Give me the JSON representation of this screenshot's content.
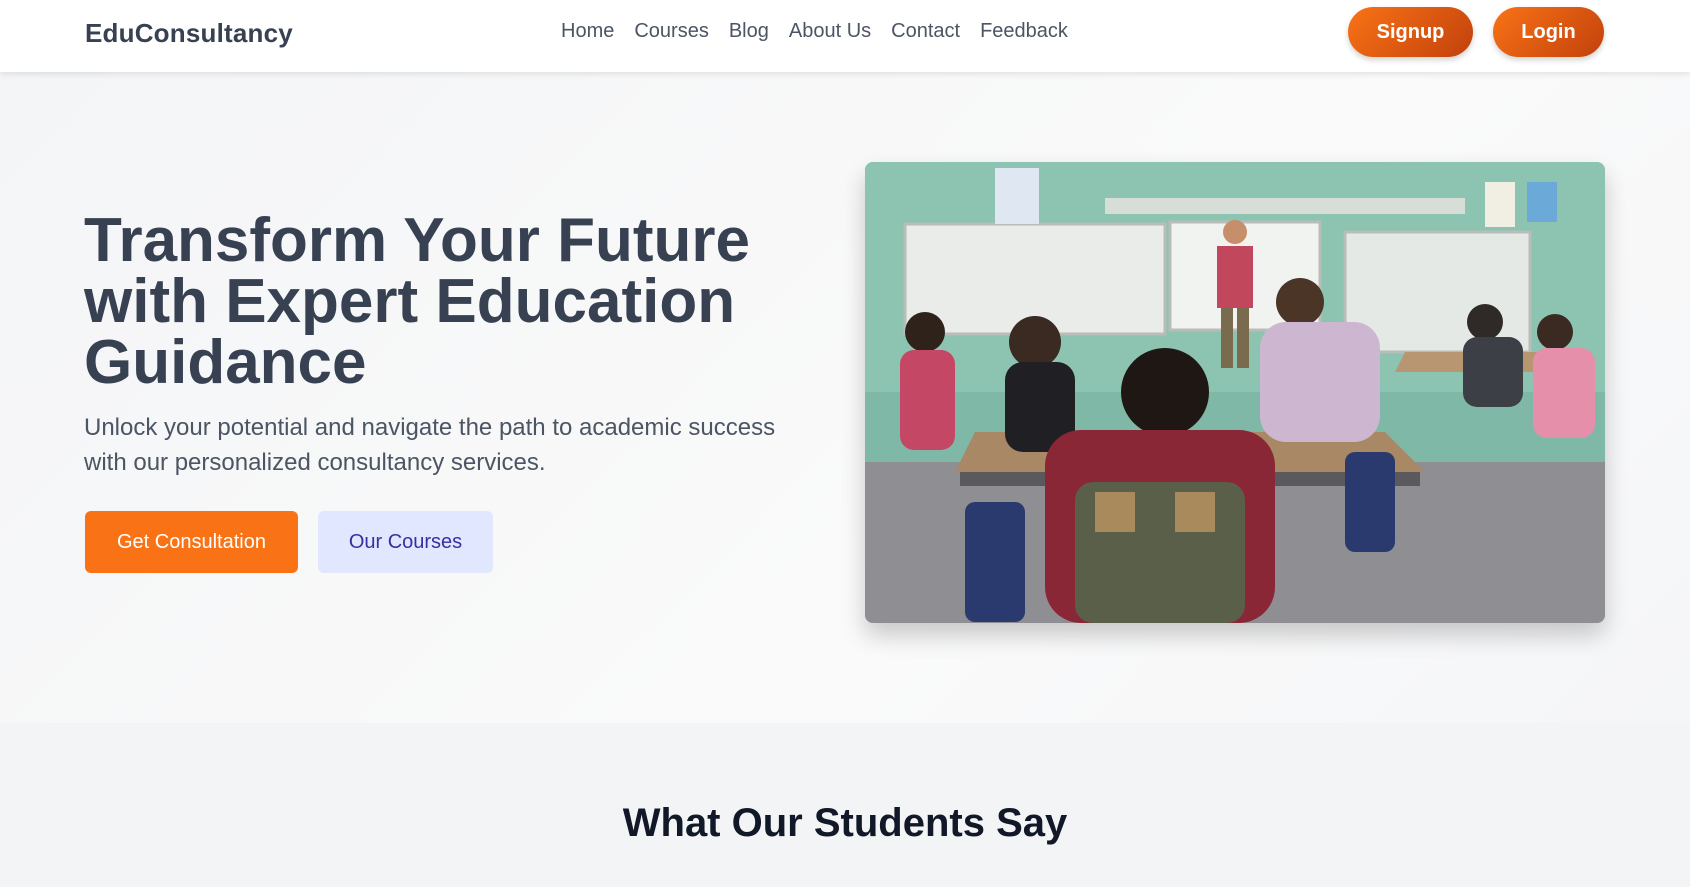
{
  "brand": {
    "name": "EduConsultancy"
  },
  "nav": {
    "links": [
      "Home",
      "Courses",
      "Blog",
      "About Us",
      "Contact",
      "Feedback"
    ],
    "signup_label": "Signup",
    "login_label": "Login"
  },
  "hero": {
    "title": "Transform Your Future with Expert Education Guidance",
    "subtitle": "Unlock your potential and navigate the path to academic success with our personalized consultancy services.",
    "primary_cta": "Get Consultation",
    "secondary_cta": "Our Courses",
    "image_icon": "classroom-photo"
  },
  "testimonials": {
    "title": "What Our Students Say"
  },
  "colors": {
    "accent": "#f97316",
    "accent_dark": "#c2410c",
    "secondary_bg": "#e0e7ff",
    "secondary_text": "#3730a3",
    "heading": "#374151"
  }
}
